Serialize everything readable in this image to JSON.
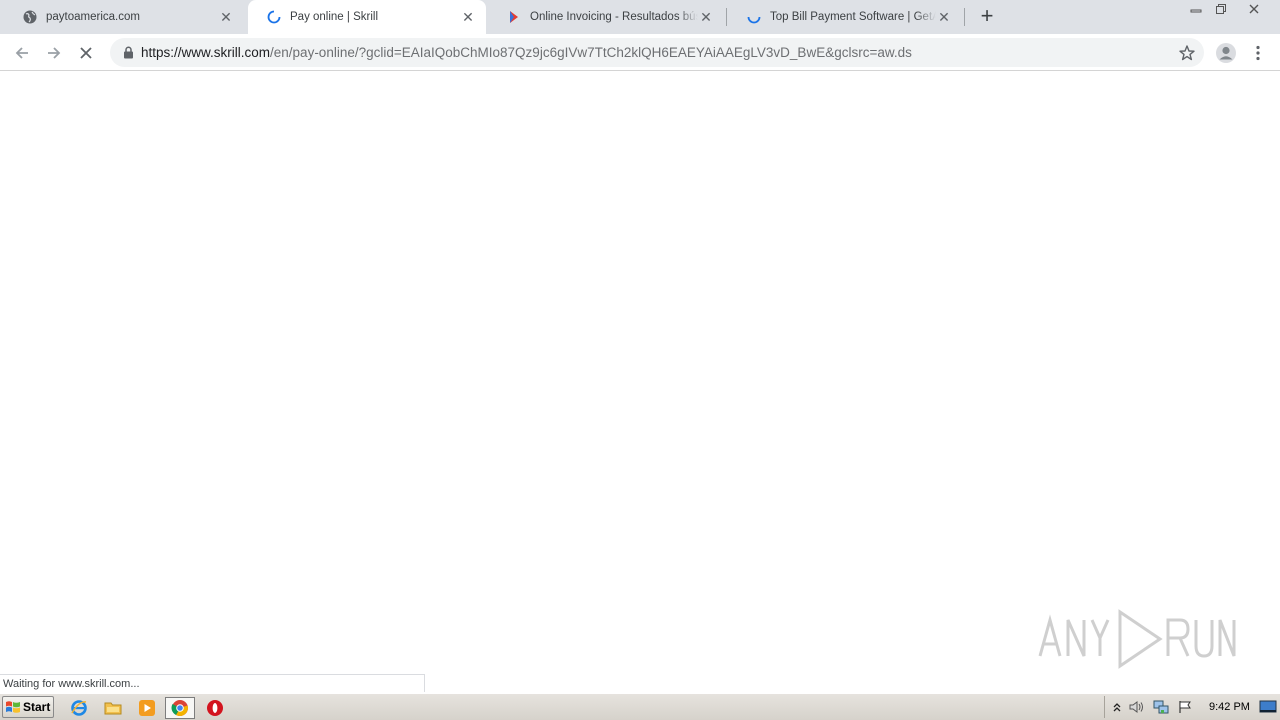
{
  "browser": {
    "tabs": [
      {
        "title": "paytoamerica.com",
        "icon": "globe-icon",
        "active": false
      },
      {
        "title": "Pay online | Skrill",
        "icon": "loading-spinner-icon",
        "active": true
      },
      {
        "title": "Online Invoicing - Resultados búsqueda",
        "icon": "search-engine-icon",
        "active": false
      },
      {
        "title": "Top Bill Payment Software | GetApp",
        "icon": "loading-spinner-icon",
        "active": false
      }
    ],
    "new_tab_label": "+",
    "address": {
      "host": "https://www.skrill.com",
      "path": "/en/pay-online/?gclid=EAIaIQobChMIo87Qz9jc6gIVw7TtCh2klQH6EAEYAiAAEgLV3vD_BwE&gclsrc=aw.ds"
    },
    "status_text": "Waiting for www.skrill.com..."
  },
  "watermark": {
    "text": "ANY RUN"
  },
  "taskbar": {
    "start_label": "Start",
    "clock": "9:42 PM"
  },
  "colors": {
    "tabstrip_bg": "#dee1e6",
    "omnibox_bg": "#f1f3f4",
    "spinner_blue": "#1a73e8",
    "taskbar_bg": "#d6d2cb"
  }
}
